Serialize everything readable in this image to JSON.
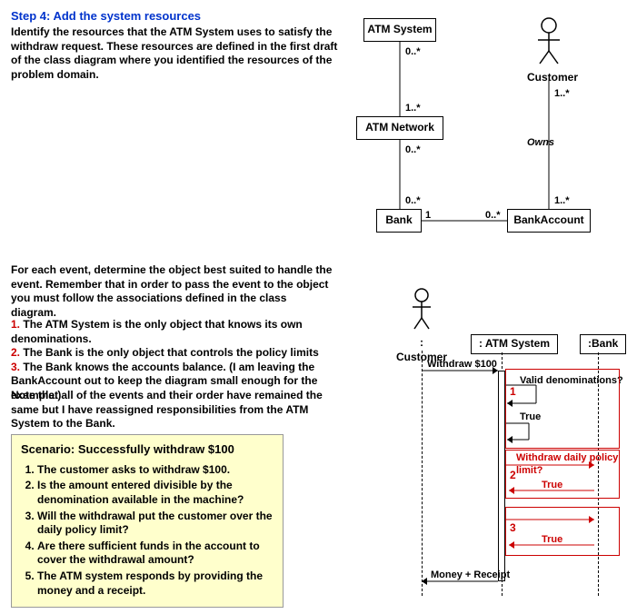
{
  "step": {
    "title": "Step 4: Add the system resources",
    "intro": "Identify the resources that the ATM System uses to satisfy the withdraw request. These resources are defined in the first draft of the class diagram where you identified the resources of the problem domain."
  },
  "class_diagram": {
    "boxes": {
      "atm_system": "ATM System",
      "atm_network": "ATM Network",
      "bank": "Bank",
      "bank_account": "BankAccount",
      "customer": "Customer"
    },
    "multiplicities": {
      "atm_system_to_network_top": "0..*",
      "atm_system_to_network_bot": "1..*",
      "network_to_bank_top": "0..*",
      "network_to_bank_bot": "0..*",
      "bank_to_account_left": "1",
      "bank_to_account_right": "0..*",
      "customer_to_account_top": "1..*",
      "customer_to_account_bot": "1..*",
      "owns": "Owns"
    }
  },
  "event_para": "For each event, determine the object best suited to handle the event. Remember that in order to pass the event to the object you must follow the associations defined in the class diagram.",
  "points": {
    "n1": "1.",
    "p1": "The ATM System is the only object that knows its own denominations.",
    "n2": "2.",
    "p2": "The Bank is the only object that controls the policy limits",
    "n3": "3.",
    "p3": "The Bank knows the accounts balance.  (I am leaving the BankAccount out to keep the diagram small enough for the example.)"
  },
  "note": "Note that all of the events and their order have remained the same but I have reassigned responsibilities from the ATM System to the Bank.",
  "scenario": {
    "title": "Scenario:  Successfully withdraw $100",
    "s1": "The customer asks to withdraw $100.",
    "s2": "Is the amount entered divisible by the denomination available in the machine?",
    "s3": "Will the withdrawal put the customer over the daily policy limit?",
    "s4": "Are there sufficient funds in the account to cover the withdrawal amount?",
    "s5": "The ATM system responds by providing the money and a receipt."
  },
  "sequence": {
    "actors": {
      "customer": ": Customer",
      "atm": ": ATM System",
      "bank": ":Bank"
    },
    "messages": {
      "withdraw": "Withdraw $100",
      "valid_denom": "Valid denominations?",
      "true": "True",
      "daily_limit": "Withdraw daily policy limit?",
      "money_receipt": "Money + Receipt"
    },
    "nums": {
      "n1": "1",
      "n2": "2",
      "n3": "3"
    }
  }
}
